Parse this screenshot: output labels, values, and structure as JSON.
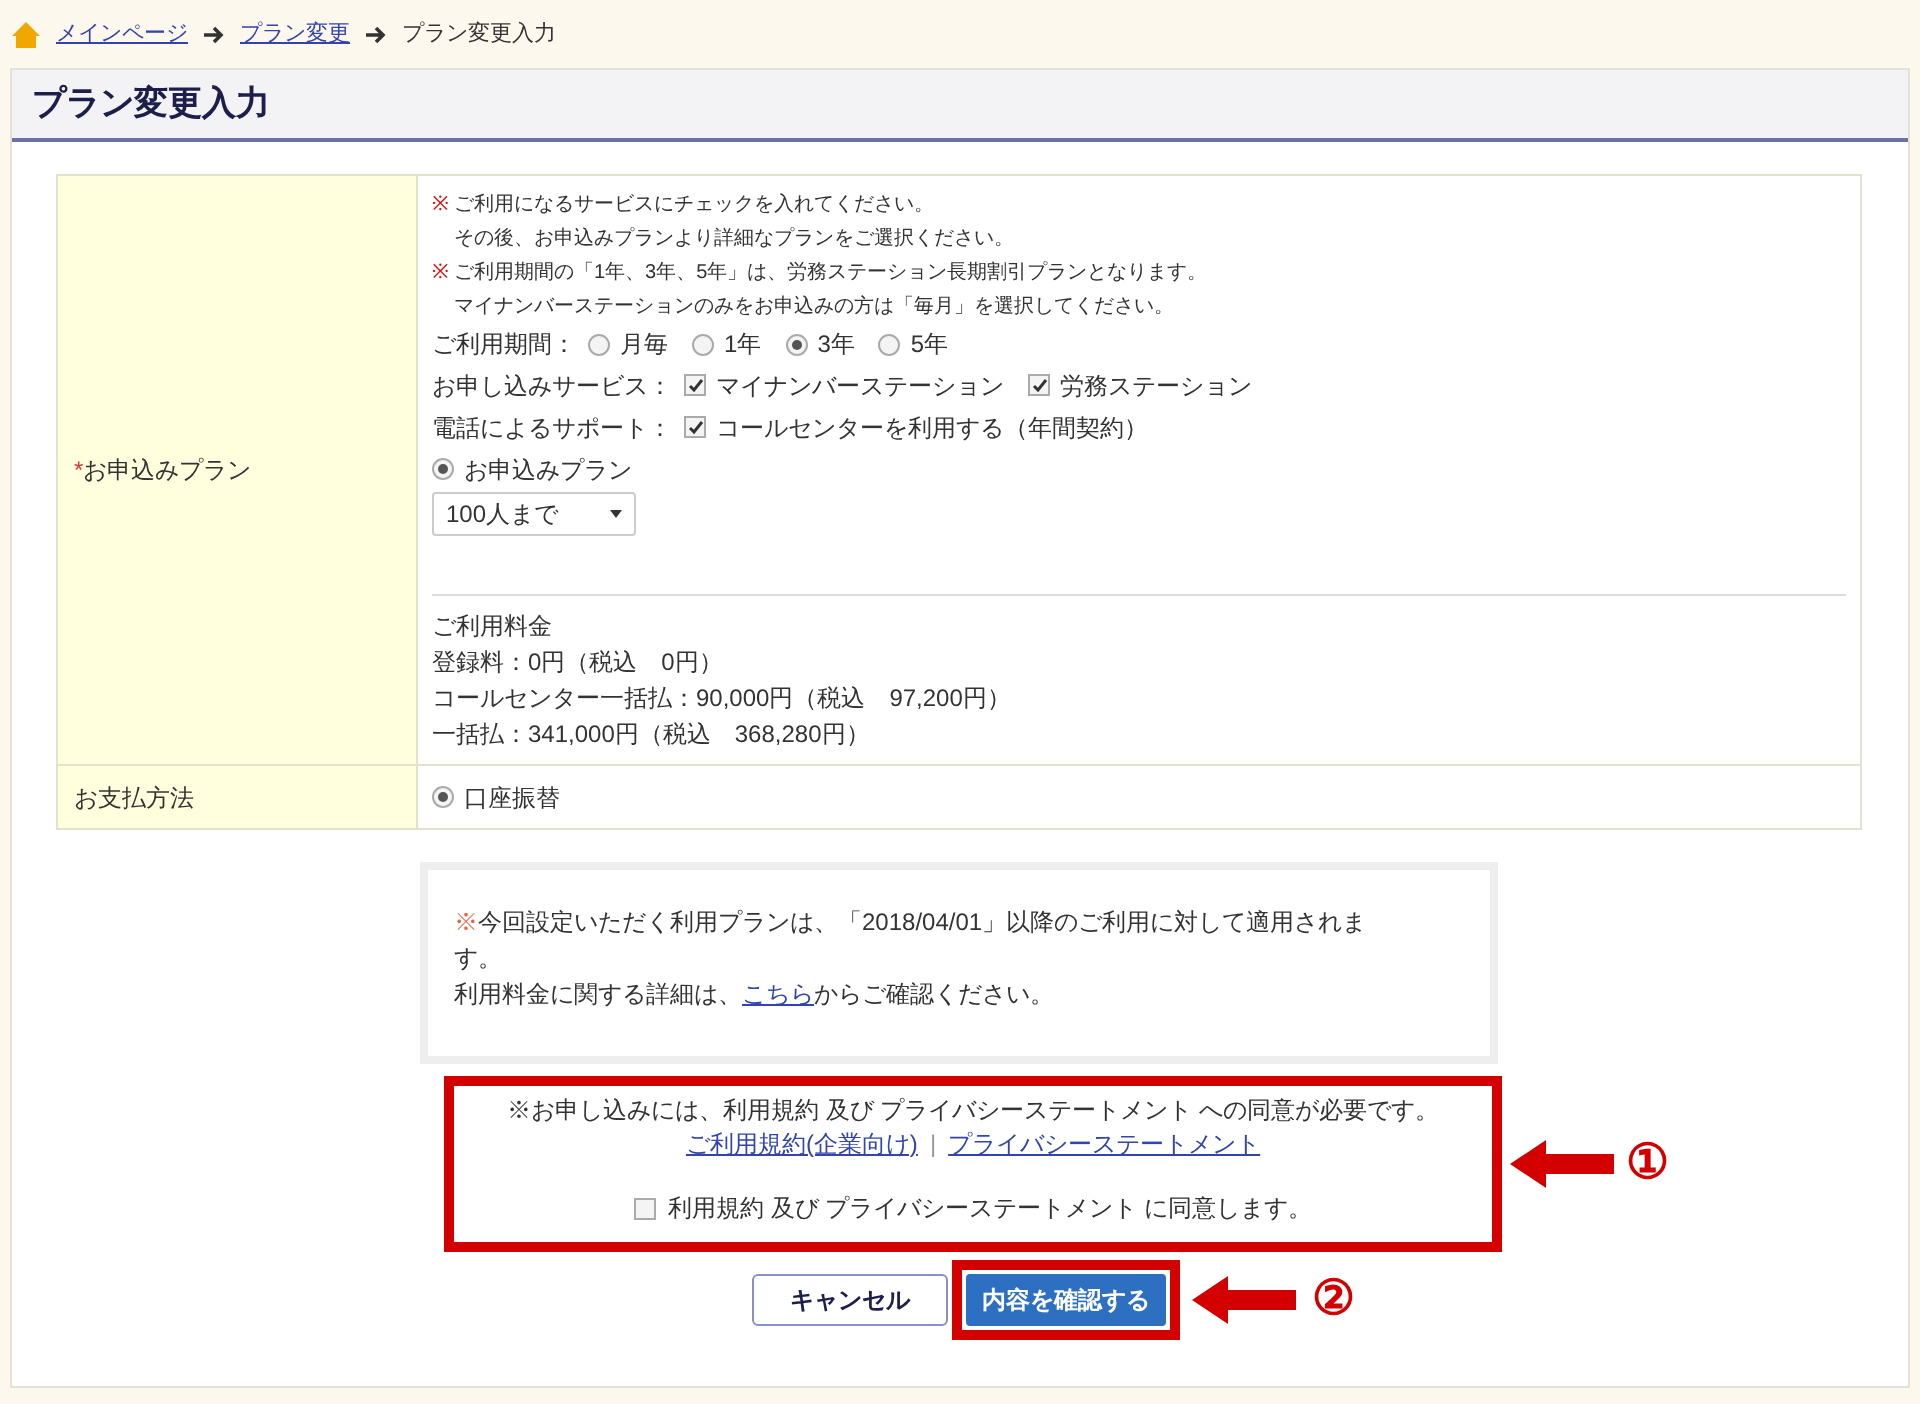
{
  "breadcrumb": [
    {
      "label": "メインページ",
      "kind": "link"
    },
    {
      "label": "プラン変更",
      "kind": "link"
    },
    {
      "label": "プラン変更入力",
      "kind": "current"
    }
  ],
  "page_title": "プラン変更入力",
  "plan_row": {
    "label": "お申込みプラン",
    "required_mark": "*",
    "notes": [
      {
        "mark": "※",
        "lines": [
          "ご利用になるサービスにチェックを入れてください。",
          "その後、お申込みプランより詳細なプランをご選択ください。"
        ]
      },
      {
        "mark": "※",
        "lines": [
          "ご利用期間の「1年、3年、5年」は、労務ステーション長期割引プランとなります。",
          "マイナンバーステーションのみをお申込みの方は「毎月」を選択してください。"
        ]
      }
    ],
    "period": {
      "label": "ご利用期間：",
      "options": [
        {
          "label": "月毎",
          "selected": false
        },
        {
          "label": "1年",
          "selected": false
        },
        {
          "label": "3年",
          "selected": true
        },
        {
          "label": "5年",
          "selected": false
        }
      ]
    },
    "services": {
      "label": "お申し込みサービス：",
      "options": [
        {
          "label": "マイナンバーステーション",
          "checked": true
        },
        {
          "label": "労務ステーション",
          "checked": true
        }
      ]
    },
    "support": {
      "label": "電話によるサポート：",
      "options": [
        {
          "label": "コールセンターを利用する（年間契約）",
          "checked": true
        }
      ]
    },
    "plan_choice": {
      "label": "お申込みプラン",
      "selected": true
    },
    "plan_select": {
      "value": "100人まで"
    },
    "fees": {
      "title": "ご利用料金",
      "lines": [
        "登録料：0円（税込　0円）",
        "コールセンター一括払：90,000円（税込　97,200円）",
        "一括払：341,000円（税込　368,280円）"
      ]
    }
  },
  "payment_row": {
    "label": "お支払方法",
    "options": [
      {
        "label": "口座振替",
        "selected": true
      }
    ]
  },
  "notice": {
    "mark": "※",
    "text": "今回設定いただく利用プランは、「2018/04/01」以降のご利用に対して適用されます。",
    "before_link": "利用料金に関する詳細は、",
    "link": "こちら",
    "after_link": "からご確認ください。"
  },
  "consent": {
    "text": "※お申し込みには、利用規約 及び プライバシーステートメント への同意が必要です。",
    "links": [
      "ご利用規約(企業向け)",
      "プライバシーステートメント"
    ],
    "separator": "|",
    "checkbox": {
      "label": "利用規約 及び プライバシーステートメント に同意します。",
      "checked": false
    }
  },
  "buttons": [
    {
      "label": "キャンセル",
      "kind": "secondary"
    },
    {
      "label": "内容を確認する",
      "kind": "primary"
    }
  ],
  "callouts": [
    "①",
    "②"
  ]
}
